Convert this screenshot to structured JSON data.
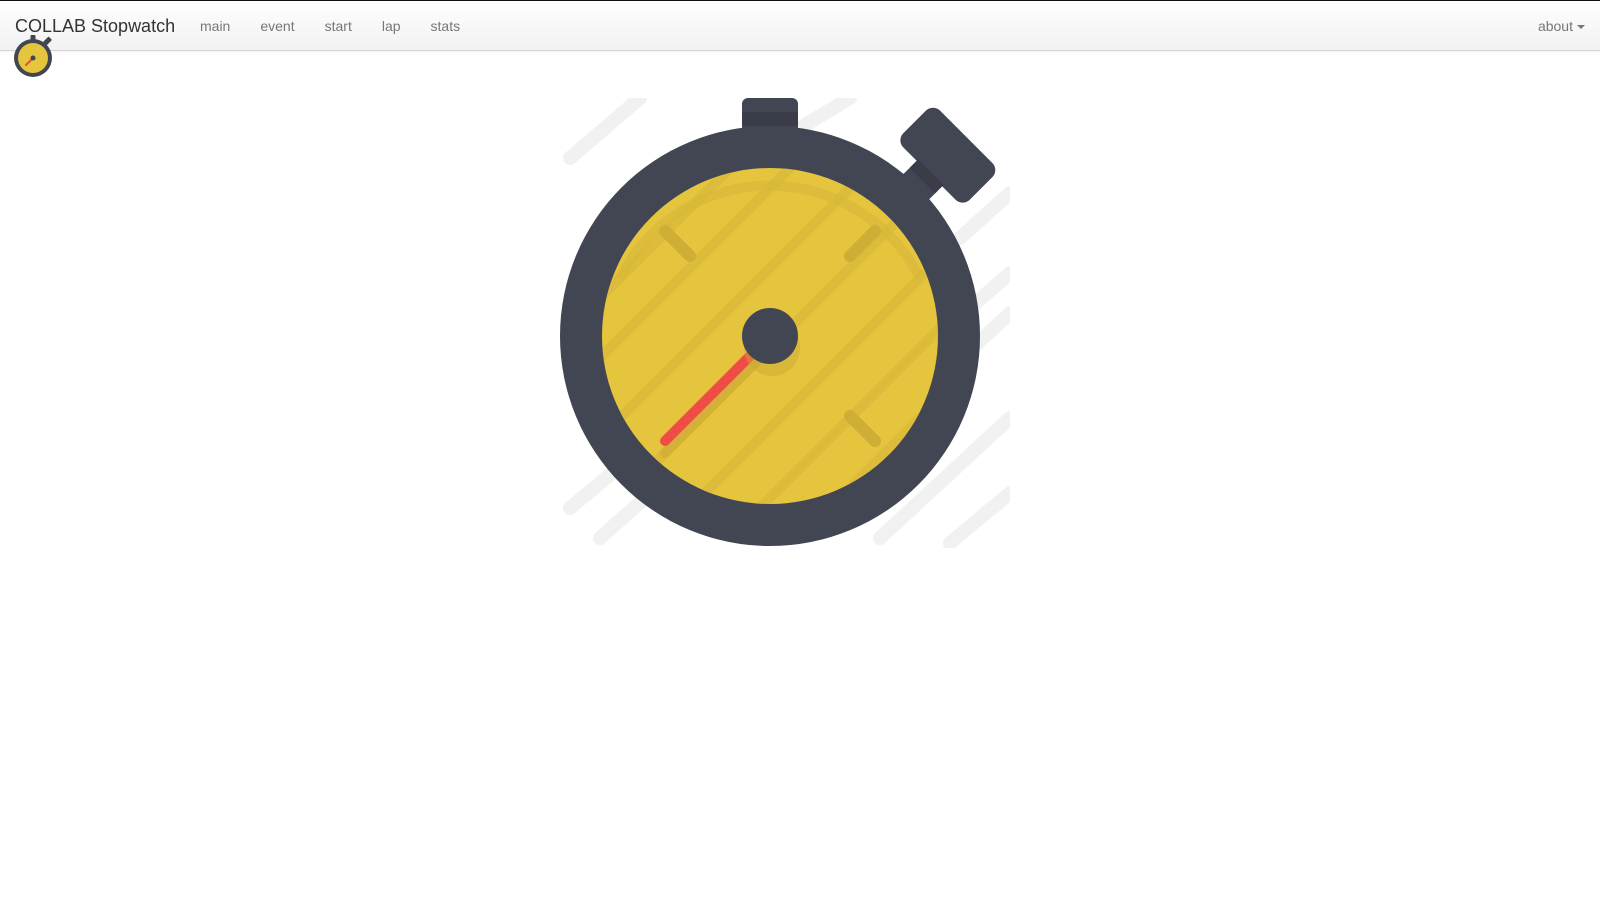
{
  "navbar": {
    "brand": "COLLAB Stopwatch",
    "items": [
      {
        "label": "main"
      },
      {
        "label": "event"
      },
      {
        "label": "start"
      },
      {
        "label": "lap"
      },
      {
        "label": "stats"
      }
    ],
    "right_menu": {
      "label": "about",
      "icon": "caret-down-icon"
    }
  },
  "logo": {
    "icon": "stopwatch-icon"
  },
  "hero": {
    "icon": "stopwatch-illustration"
  },
  "colors": {
    "dial": "#e5c43e",
    "case": "#424653",
    "hand": "#ef4c45",
    "nav_text": "#777777",
    "brand_text": "#333333"
  }
}
